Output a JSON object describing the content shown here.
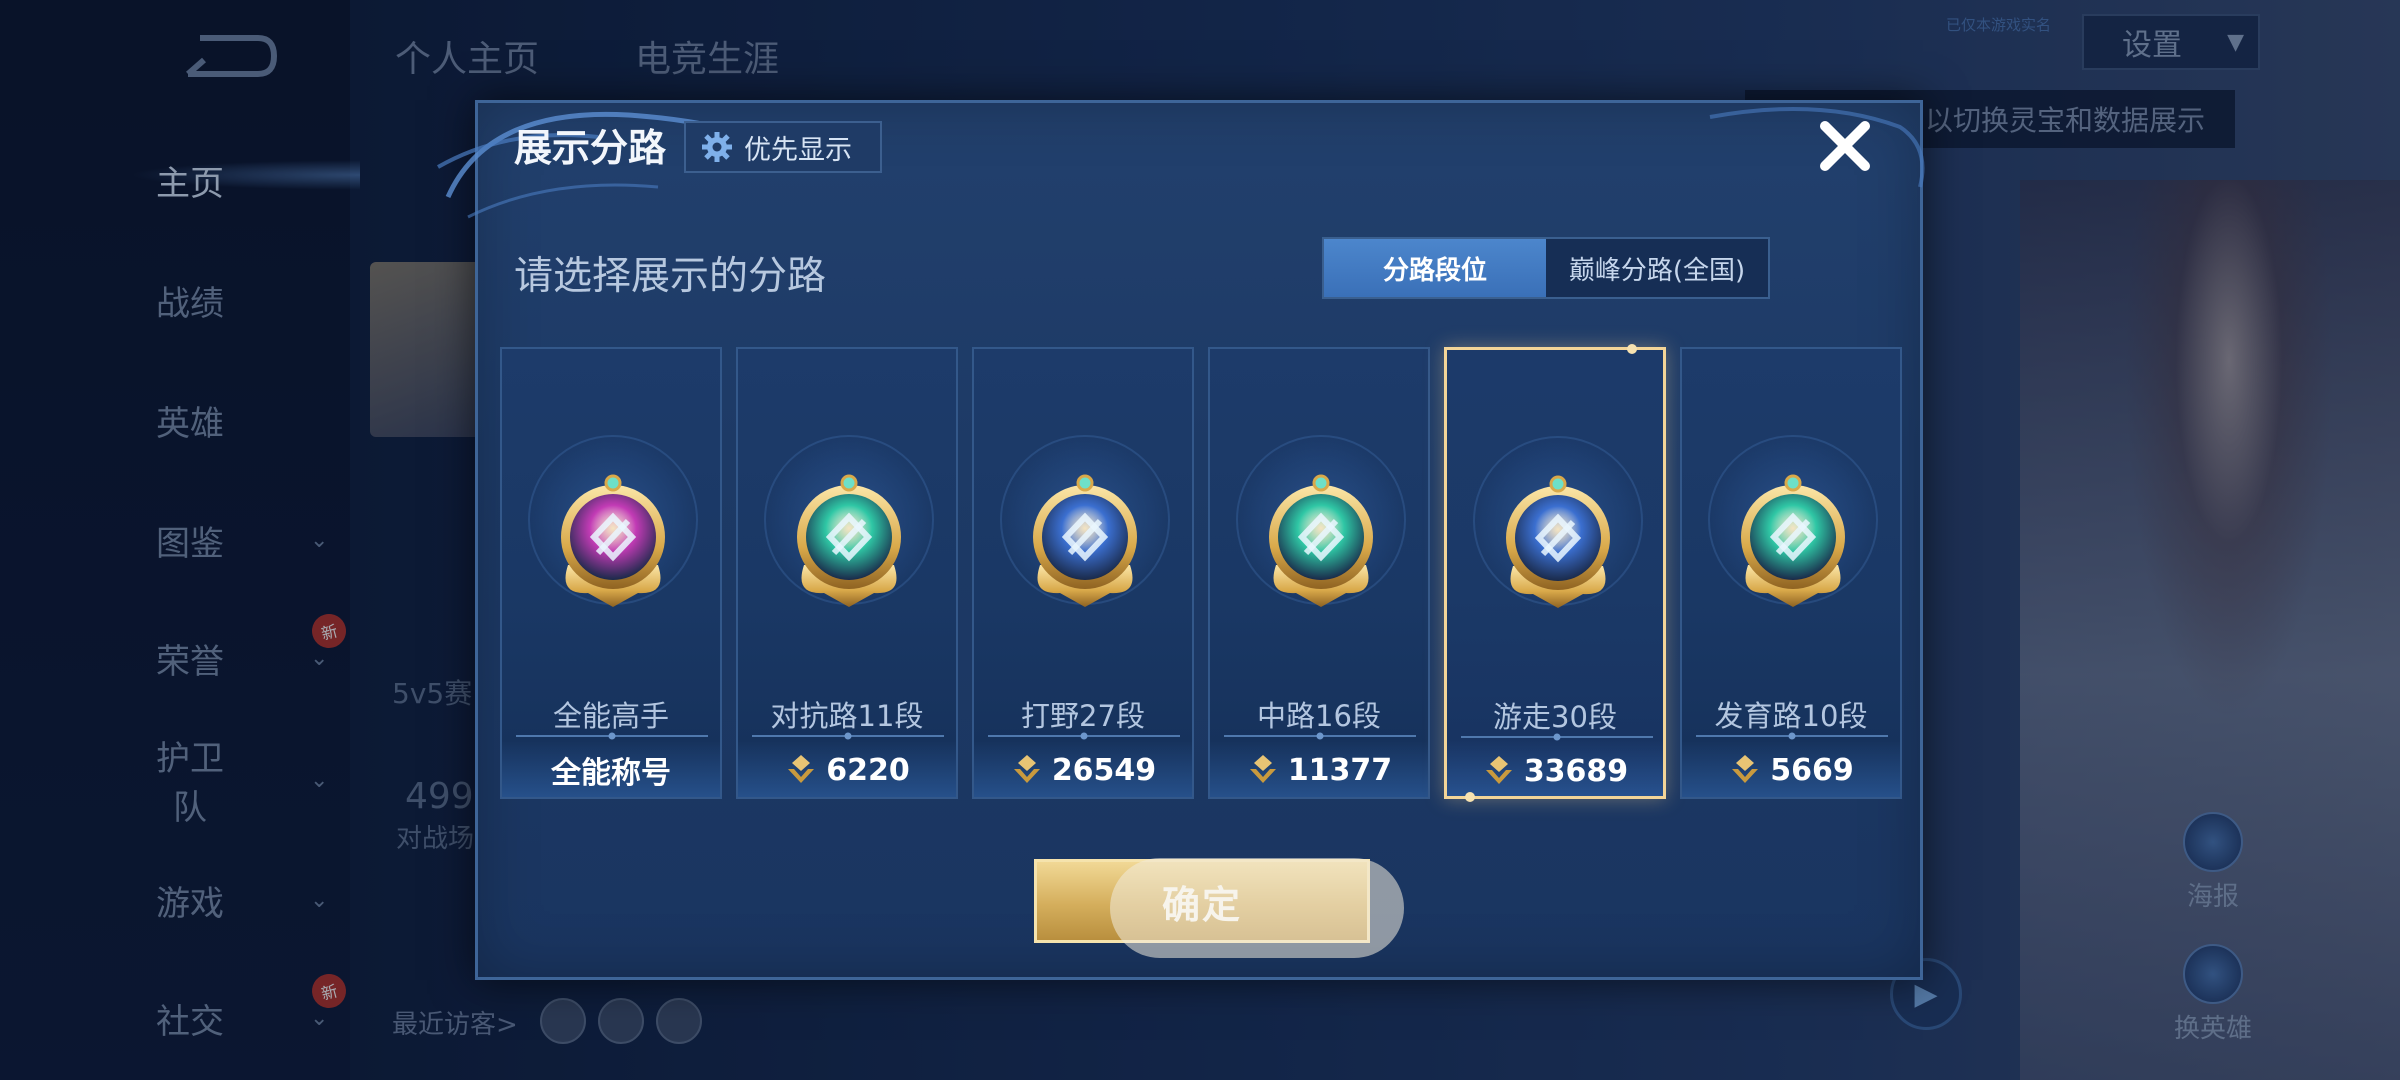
{
  "nav": {
    "back_icon": "back-arrow-icon",
    "items": [
      {
        "label": "主页",
        "active": true,
        "chevron": false,
        "new": false
      },
      {
        "label": "战绩",
        "active": false,
        "chevron": false,
        "new": false
      },
      {
        "label": "英雄",
        "active": false,
        "chevron": false,
        "new": false
      },
      {
        "label": "图鉴",
        "active": false,
        "chevron": true,
        "new": false
      },
      {
        "label": "荣誉",
        "active": false,
        "chevron": true,
        "new": true
      },
      {
        "label": "护卫队",
        "active": false,
        "chevron": true,
        "new": false
      },
      {
        "label": "游戏",
        "active": false,
        "chevron": true,
        "new": false
      },
      {
        "label": "社交",
        "active": false,
        "chevron": true,
        "new": true
      }
    ],
    "chevron_glyph": "⌄",
    "new_badge": "新"
  },
  "header": {
    "tabs": [
      "个人主页",
      "电竞生涯"
    ],
    "settings_label": "设置",
    "settings_arrow": "▼",
    "small_note": "已仅本游戏实名",
    "hint": "以切换灵宝和数据展示"
  },
  "background": {
    "mode_text": "5v5赛",
    "number_text": "499",
    "number_sub": "对战场",
    "visitors_label": "最近访客>",
    "side_buttons": [
      "海报",
      "换英雄"
    ]
  },
  "dialog": {
    "title": "展示分路",
    "priority_label": "优先显示",
    "prompt": "请选择展示的分路",
    "toggle": [
      {
        "label": "分路段位",
        "active": true
      },
      {
        "label": "巅峰分路(全国)",
        "active": false
      }
    ],
    "confirm_label": "确定",
    "cards": [
      {
        "rank": "全能高手",
        "score": "全能称号",
        "has_points_icon": false,
        "selected": false,
        "badge_color": "#c23bb5",
        "badge_icon": "all-round-badge-icon"
      },
      {
        "rank": "对抗路11段",
        "score": "6220",
        "has_points_icon": true,
        "selected": false,
        "badge_color": "#2fc7a5",
        "badge_icon": "clash-lane-badge-icon"
      },
      {
        "rank": "打野27段",
        "score": "26549",
        "has_points_icon": true,
        "selected": false,
        "badge_color": "#3b6fd0",
        "badge_icon": "jungle-badge-icon"
      },
      {
        "rank": "中路16段",
        "score": "11377",
        "has_points_icon": true,
        "selected": false,
        "badge_color": "#2fc7a5",
        "badge_icon": "mid-lane-badge-icon"
      },
      {
        "rank": "游走30段",
        "score": "33689",
        "has_points_icon": true,
        "selected": true,
        "badge_color": "#3b6fd0",
        "badge_icon": "roam-badge-icon"
      },
      {
        "rank": "发育路10段",
        "score": "5669",
        "has_points_icon": true,
        "selected": false,
        "badge_color": "#2fc7a5",
        "badge_icon": "farm-lane-badge-icon"
      }
    ]
  },
  "colors": {
    "accent_gold": "#f3d598",
    "toggle_active": "#4c86cc",
    "dialog_bg": "#1d3a66"
  }
}
